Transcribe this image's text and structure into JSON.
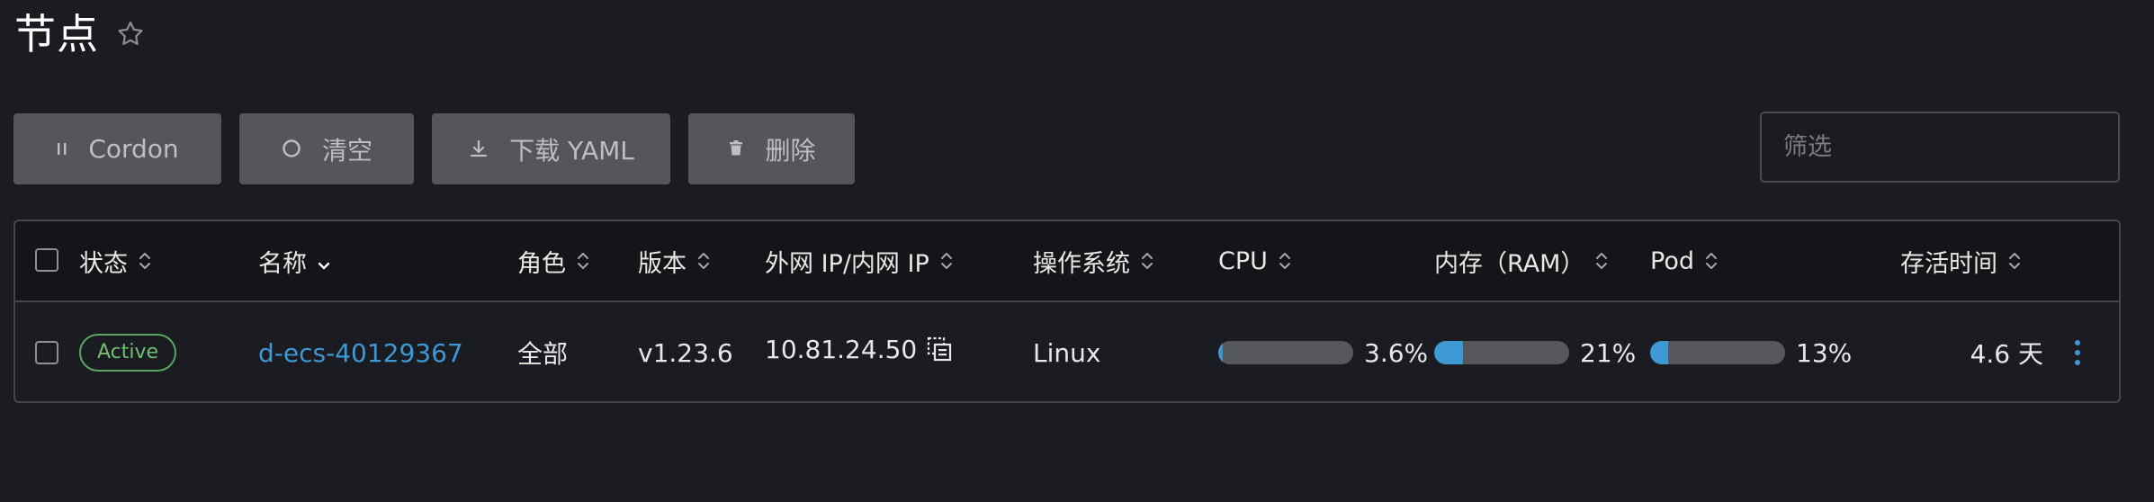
{
  "header": {
    "title": "节点",
    "star_icon": "star-outline-icon"
  },
  "toolbar": {
    "cordon_label": "Cordon",
    "cordon_icon": "pause-icon",
    "drain_label": "清空",
    "drain_icon": "circle-icon",
    "download_label": "下载 YAML",
    "download_icon": "download-icon",
    "delete_label": "删除",
    "delete_icon": "trash-icon",
    "filter_placeholder": "筛选",
    "filter_value": ""
  },
  "table": {
    "columns": [
      {
        "key": "state",
        "label": "状态"
      },
      {
        "key": "name",
        "label": "名称"
      },
      {
        "key": "role",
        "label": "角色"
      },
      {
        "key": "version",
        "label": "版本"
      },
      {
        "key": "ip",
        "label": "外网 IP/内网 IP"
      },
      {
        "key": "os",
        "label": "操作系统"
      },
      {
        "key": "cpu",
        "label": "CPU"
      },
      {
        "key": "ram",
        "label": "内存（RAM）"
      },
      {
        "key": "pod",
        "label": "Pod"
      },
      {
        "key": "age",
        "label": "存活时间"
      }
    ],
    "rows": [
      {
        "state": "Active",
        "name": "d-ecs-40129367",
        "role": "全部",
        "version": "v1.23.6",
        "ip": "10.81.24.50",
        "os": "Linux",
        "cpu": {
          "text": "3.6%",
          "fraction": 0.036
        },
        "ram": {
          "text": "21%",
          "fraction": 0.21
        },
        "pod": {
          "text": "13%",
          "fraction": 0.13
        },
        "age": "4.6 天"
      }
    ]
  },
  "colors": {
    "background": "#1b1c21",
    "header_bg": "#141518",
    "button_bg": "#55565c",
    "accent": "#3d98d3",
    "active_green": "#5ba55d"
  }
}
